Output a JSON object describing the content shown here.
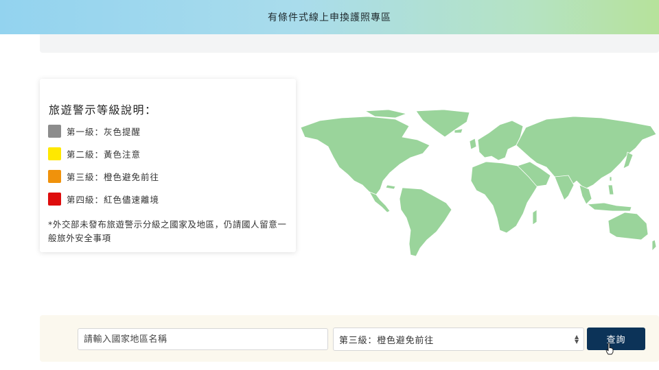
{
  "header": {
    "title": "有條件式線上申換護照專區"
  },
  "legend": {
    "title": "旅遊警示等級說明：",
    "items": [
      {
        "label": "第一級：灰色提醒",
        "color": "#8c8c8c"
      },
      {
        "label": "第二級：黃色注意",
        "color": "#ffe800"
      },
      {
        "label": "第三級：橙色避免前往",
        "color": "#f0920b"
      },
      {
        "label": "第四級：紅色儘速離境",
        "color": "#de0d0d"
      }
    ],
    "note": "*外交部未發布旅遊警示分級之國家及地區，仍請國人留意一般旅外安全事項"
  },
  "map": {
    "land_color": "#9ad49b",
    "border_color": "#ffffff"
  },
  "search": {
    "country_placeholder": "請輸入國家地區名稱",
    "level_selected": "第三級：橙色避免前往",
    "submit_label": "查詢"
  },
  "colors": {
    "button": "#0c3358",
    "panel": "#fbf8ee"
  }
}
